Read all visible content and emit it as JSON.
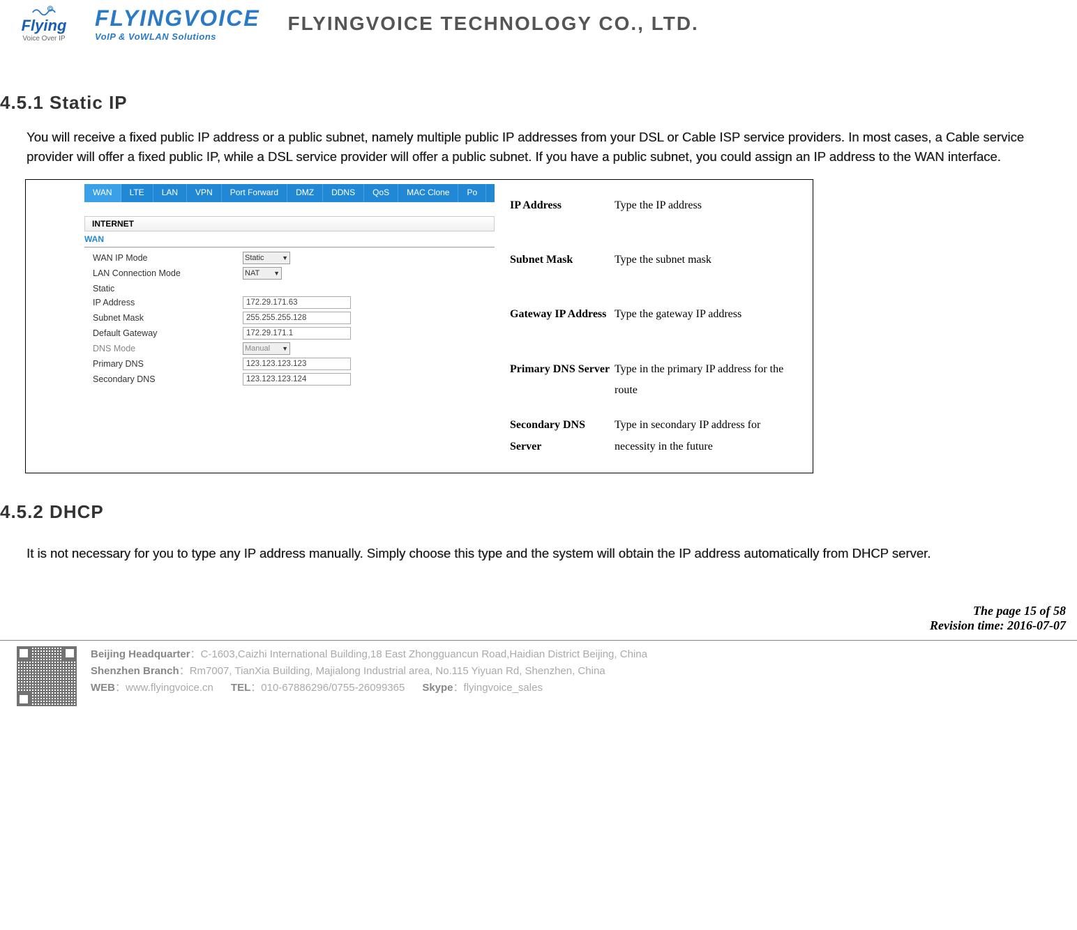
{
  "header": {
    "logo1_main": "Flying",
    "logo1_sub": "Voice Over IP",
    "logo2_top": "FLYINGVOICE",
    "logo2_bottom": "VoIP & VoWLAN Solutions",
    "company": "FLYINGVOICE TECHNOLOGY CO., LTD."
  },
  "s1": {
    "title": "4.5.1 Static IP",
    "body": "You will receive a fixed public IP address or a public subnet, namely multiple public IP addresses from your DSL or Cable ISP service providers. In most cases, a Cable service provider will offer a fixed public IP, while a DSL service provider will offer a public subnet. If you have a public subnet, you could assign an IP address to the WAN interface."
  },
  "tabs": [
    "WAN",
    "LTE",
    "LAN",
    "VPN",
    "Port Forward",
    "DMZ",
    "DDNS",
    "QoS",
    "MAC Clone",
    "Po"
  ],
  "internet": "INTERNET",
  "wan_hdr": "WAN",
  "form": {
    "wan_ip_mode_k": "WAN IP Mode",
    "wan_ip_mode_v": "Static",
    "lan_conn_k": "LAN Connection Mode",
    "lan_conn_v": "NAT",
    "static_hdr": "Static",
    "ip_k": "IP Address",
    "ip_v": "172.29.171.63",
    "mask_k": "Subnet Mask",
    "mask_v": "255.255.255.128",
    "gw_k": "Default Gateway",
    "gw_v": "172.29.171.1",
    "dns_k": "DNS Mode",
    "dns_v": "Manual",
    "pdns_k": "Primary DNS",
    "pdns_v": "123.123.123.123",
    "sdns_k": "Secondary DNS",
    "sdns_v": "123.123.123.124"
  },
  "desc": [
    {
      "term": "IP Address",
      "val": "Type the IP address"
    },
    {
      "term": "Subnet Mask",
      "val": "Type the subnet mask"
    },
    {
      "term": "Gateway IP Address",
      "val": "Type the gateway IP address"
    },
    {
      "term": "Primary DNS Server",
      "val": "Type in the primary IP address for the route"
    },
    {
      "term": "Secondary DNS Server",
      "val": "Type in secondary IP address for necessity in the future"
    }
  ],
  "s2": {
    "title": "4.5.2 DHCP",
    "body": "It is not necessary for you to type any IP address manually. Simply choose this type and the system will obtain the IP address automatically from DHCP server."
  },
  "footer": {
    "page": "The page 15 of 58",
    "rev": "Revision time: 2016-07-07",
    "hq_lbl": "Beijing Headquarter",
    "hq_sep": "：",
    "hq": "C-1603,Caizhi International Building,18 East Zhongguancun Road,Haidian District Beijing, China",
    "sz_lbl": "Shenzhen Branch",
    "sz_sep": "：",
    "sz": "Rm7007, TianXia Building, Majialong Industrial area, No.115 Yiyuan Rd, Shenzhen, China",
    "web_lbl": "WEB",
    "web_sep": "：",
    "web": "www.flyingvoice.cn",
    "tel_lbl": "TEL",
    "tel_sep": "：",
    "tel": "010-67886296/0755-26099365",
    "skype_lbl": "Skype",
    "skype_sep": "：",
    "skype": "flyingvoice_sales"
  }
}
